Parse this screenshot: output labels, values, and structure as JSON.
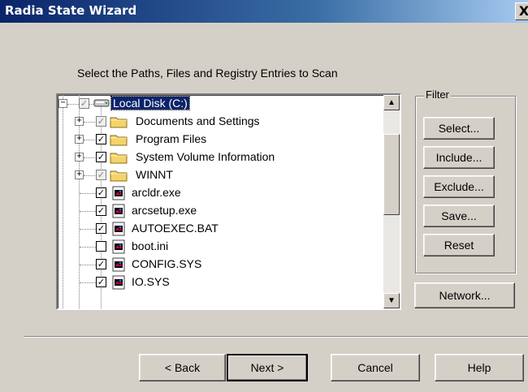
{
  "window": {
    "title": "Radia State Wizard",
    "close_glyph": "X"
  },
  "instruction": "Select the Paths, Files and Registry Entries to Scan",
  "tree": {
    "items": [
      {
        "label": "Local Disk (C:)",
        "type": "drive",
        "expander": "−",
        "check": "gray",
        "selected": true
      },
      {
        "label": "Documents and Settings",
        "type": "folder",
        "expander": "+",
        "check": "gray"
      },
      {
        "label": "Program Files",
        "type": "folder",
        "expander": "+",
        "check": "checked"
      },
      {
        "label": "System Volume Information",
        "type": "folder",
        "expander": "+",
        "check": "checked"
      },
      {
        "label": "WINNT",
        "type": "folder",
        "expander": "+",
        "check": "gray"
      },
      {
        "label": "arcldr.exe",
        "type": "file",
        "check": "checked"
      },
      {
        "label": "arcsetup.exe",
        "type": "file",
        "check": "checked"
      },
      {
        "label": "AUTOEXEC.BAT",
        "type": "file",
        "check": "checked"
      },
      {
        "label": "boot.ini",
        "type": "file",
        "check": "unchecked"
      },
      {
        "label": "CONFIG.SYS",
        "type": "file",
        "check": "checked"
      },
      {
        "label": "IO.SYS",
        "type": "file",
        "check": "checked"
      }
    ]
  },
  "filter": {
    "label": "Filter",
    "buttons": [
      "Select...",
      "Include...",
      "Exclude...",
      "Save...",
      "Reset"
    ]
  },
  "network_button": "Network...",
  "footer": {
    "back": "< Back",
    "next": "Next >",
    "cancel": "Cancel",
    "help": "Help"
  }
}
